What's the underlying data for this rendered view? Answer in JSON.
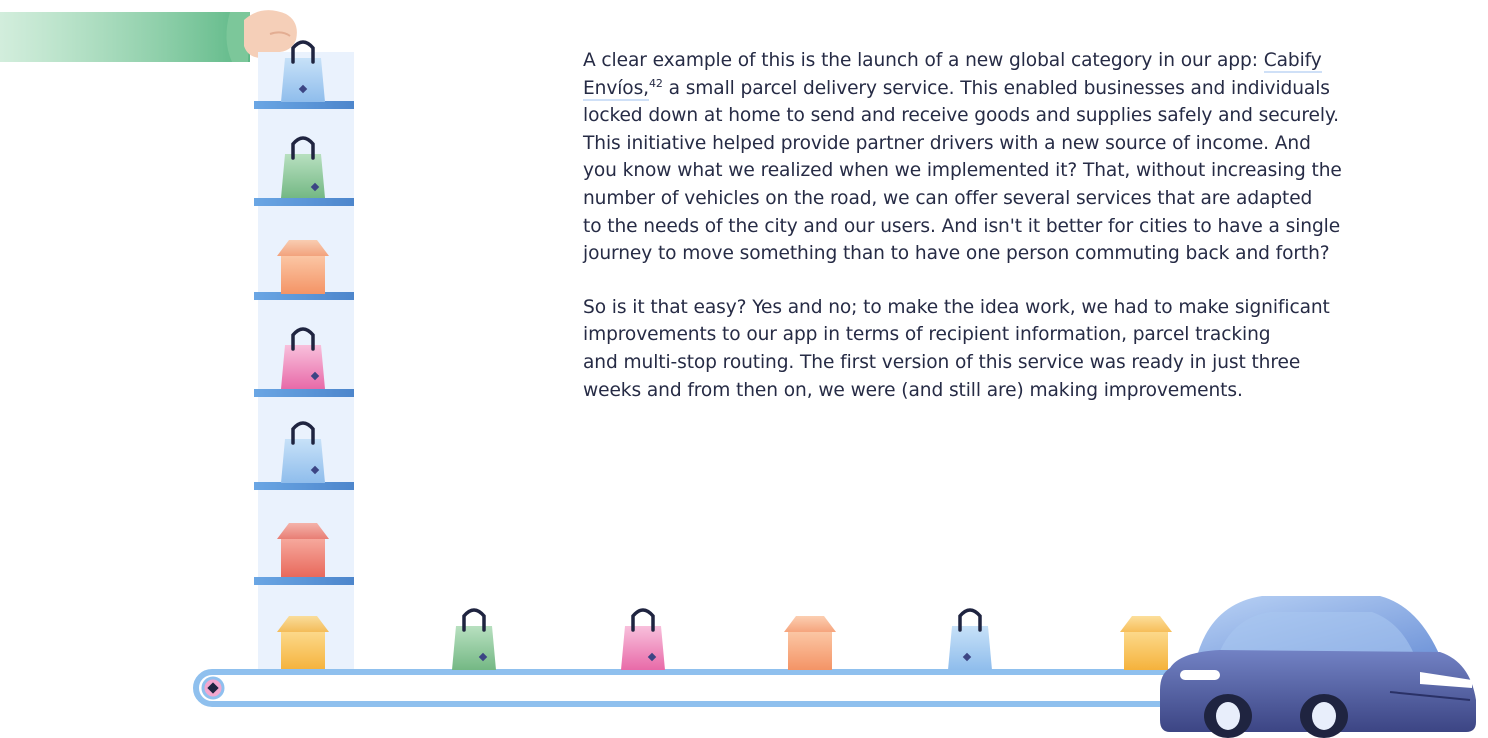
{
  "article": {
    "paragraph_1": {
      "line_1_prefix": "A clear example of this is the launch of a new global category in our app: ",
      "link_part_1": "Cabify",
      "link_part_2": "Envíos,",
      "footnote": "42",
      "line_2_suffix": " a small parcel delivery service. This enabled businesses and individuals",
      "line_3": "locked down at home to send and receive goods and supplies safely and securely.",
      "line_4": "This initiative helped provide partner drivers with a new source of income. And",
      "line_5": "you know what we realized when we implemented it? That, without increasing the",
      "line_6": "number of vehicles on the road, we can offer several services that are adapted",
      "line_7": "to the needs of the city and our users. And isn't it better for cities to have a single",
      "line_8": "journey to move something than to have one person commuting back and forth?"
    },
    "paragraph_2": {
      "line_1": "So is it that easy? Yes and no; to make the idea work, we had to make significant",
      "line_2": "improvements to our app in terms of recipient information, parcel tracking",
      "line_3": "and multi-stop routing. The first version of this service was ready in just three",
      "line_4": "weeks and from then on, we were (and still are) making improvements."
    }
  },
  "illustration": {
    "description_icons": [
      "hand-icon",
      "shopping-bag-icon",
      "parcel-box-icon",
      "conveyor-belt-icon",
      "car-icon"
    ],
    "colors": {
      "shelf": "#5b95d8",
      "column_bg": "#eaf2fd",
      "belt": "#8fc0ee",
      "bag_blue": "#9cc7f0",
      "bag_green": "#8fcb9b",
      "bag_pink": "#f08ec0",
      "box_orange": "#f6a679",
      "box_red": "#ef7f72",
      "box_yellow": "#f8c257",
      "car_body": "#4f5a9e",
      "car_roof": "#8aaee6",
      "sleeve": "#6bc08f"
    }
  }
}
